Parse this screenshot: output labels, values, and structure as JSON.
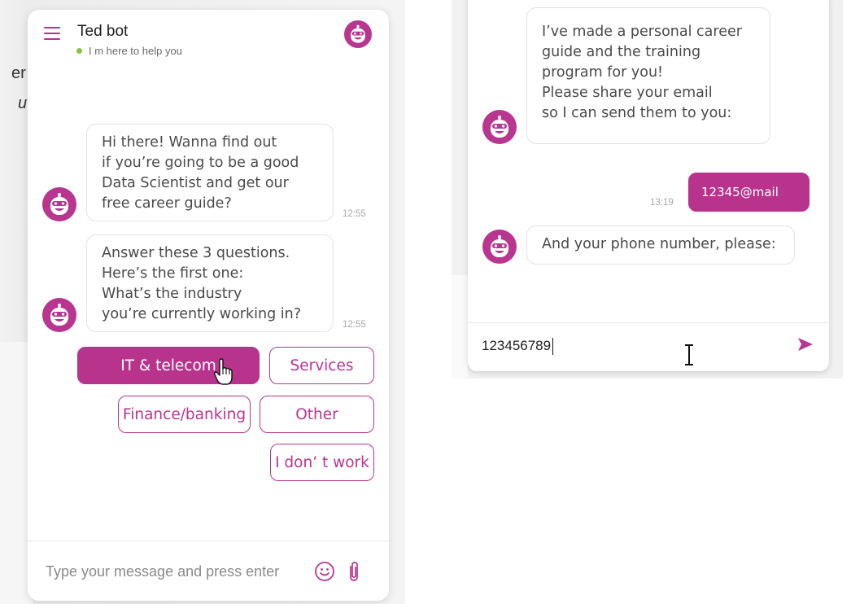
{
  "colors": {
    "brand": "#b8338c",
    "online": "#8bc34a",
    "bubble_text": "#4a4a4a",
    "time_text": "#a8a8a8"
  },
  "background_fragments": [
    "er",
    "и"
  ],
  "left_chat": {
    "header": {
      "menu_icon": "hamburger-menu-icon",
      "title": "Ted bot",
      "status": "I  m here to help you",
      "avatar_icon": "robot-avatar-icon"
    },
    "messages": [
      {
        "sender": "bot",
        "text": "Hi there! Wanna find out\nif you’re going to be a good\nData Scientist and get our\nfree career guide?",
        "time": "12:55"
      },
      {
        "sender": "bot",
        "text": "Answer these 3 questions.\nHere’s the first one:\nWhat’s the industry\nyou’re currently working in?",
        "time": "12:55"
      }
    ],
    "quick_replies": [
      {
        "label": "IT & telecom",
        "selected": true
      },
      {
        "label": "Services",
        "selected": false
      },
      {
        "label": "Finance/banking",
        "selected": false
      },
      {
        "label": "Other",
        "selected": false
      },
      {
        "label": "I don’ t work",
        "selected": false
      }
    ],
    "composer": {
      "placeholder": "Type your message and press enter",
      "value": "",
      "emoji_icon": "smiley-icon",
      "attach_icon": "paperclip-icon"
    }
  },
  "right_chat": {
    "messages": [
      {
        "sender": "bot",
        "text": "I’ve made a personal career\nguide and the training\nprogram for you!\nPlease share your email\nso I can send them to you:"
      },
      {
        "sender": "user",
        "text": "12345@mail",
        "time": "13:19"
      },
      {
        "sender": "bot",
        "text": "And your phone number, please:"
      }
    ],
    "composer": {
      "value": "123456789",
      "send_icon": "send-arrow-icon"
    }
  }
}
